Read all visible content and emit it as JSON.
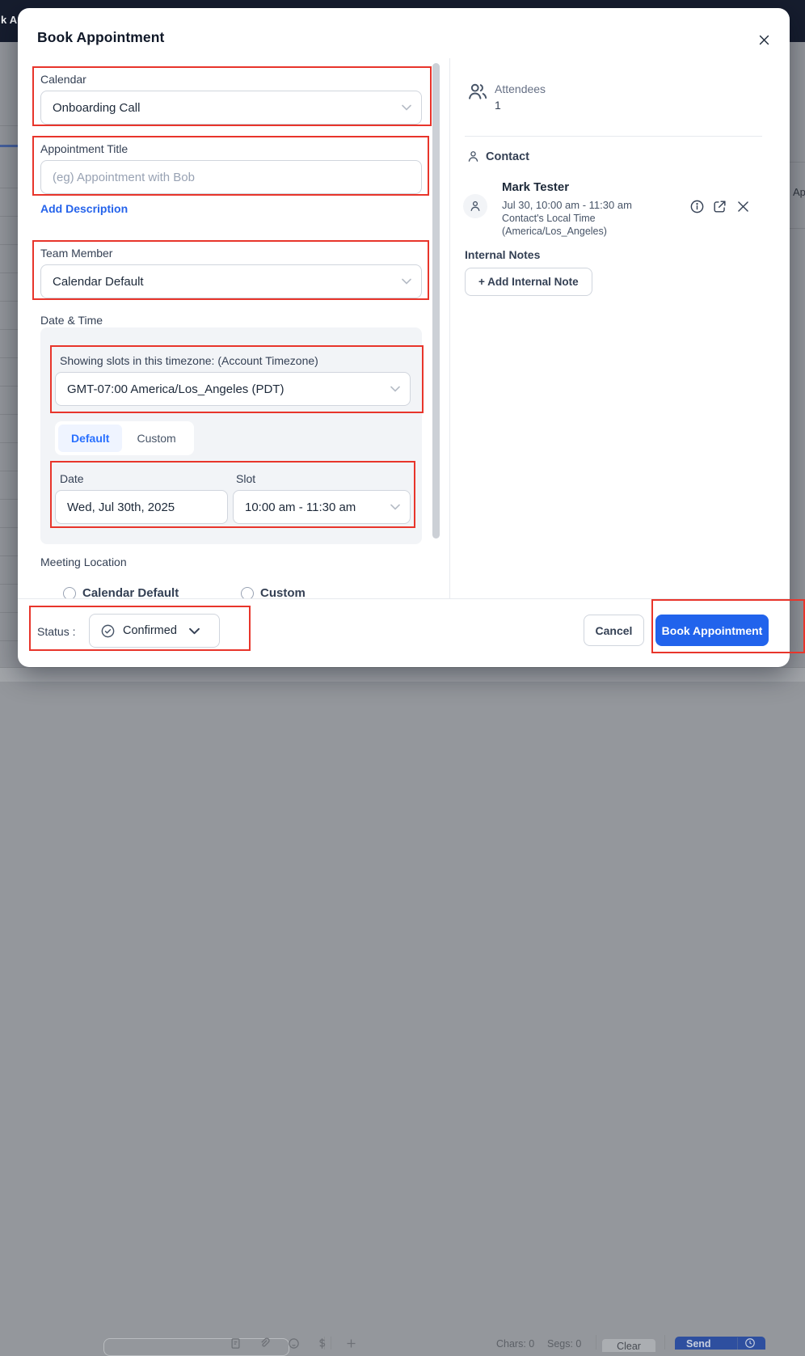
{
  "modal": {
    "title": "Book Appointment",
    "calendar": {
      "label": "Calendar",
      "value": "Onboarding Call"
    },
    "appointment": {
      "label": "Appointment Title",
      "placeholder": "(eg) Appointment with Bob"
    },
    "add_description": "Add Description",
    "team_member": {
      "label": "Team Member",
      "value": "Calendar Default"
    },
    "date_time": {
      "section_label": "Date & Time",
      "timezone_label": "Showing slots in this timezone: (Account Timezone)",
      "timezone_value": "GMT-07:00 America/Los_Angeles (PDT)",
      "tab_default": "Default",
      "tab_custom": "Custom",
      "date_label": "Date",
      "date_value": "Wed, Jul 30th, 2025",
      "slot_label": "Slot",
      "slot_value": "10:00 am - 11:30 am"
    },
    "location": {
      "label": "Meeting Location",
      "option_default": "Calendar Default",
      "option_custom": "Custom"
    },
    "right": {
      "attendees_label": "Attendees",
      "attendees_count": "1",
      "contact_label": "Contact",
      "contact_name": "Mark Tester",
      "contact_time": "Jul 30, 10:00 am - 11:30 am",
      "contact_tz_line1": "Contact's Local Time",
      "contact_tz_line2": "(America/Los_Angeles)",
      "internal_notes_label": "Internal Notes",
      "add_internal_note": "+ Add Internal Note"
    },
    "footer": {
      "status_label": "Status :",
      "status_value": "Confirmed",
      "cancel": "Cancel",
      "book": "Book Appointment"
    }
  },
  "background": {
    "topbar_text": "k Ac",
    "right_edge_text": "Ap",
    "bottom": {
      "chars": "Chars: 0",
      "segs": "Segs: 0",
      "clear": "Clear",
      "send": "Send"
    }
  },
  "colors": {
    "accent_blue": "#2163ec",
    "link_blue": "#2563eb",
    "annotation_red": "#e8352b",
    "tab_active_bg": "#eff4ff",
    "tab_active_text": "#2970ff",
    "topbar_navy": "#161d2e"
  }
}
